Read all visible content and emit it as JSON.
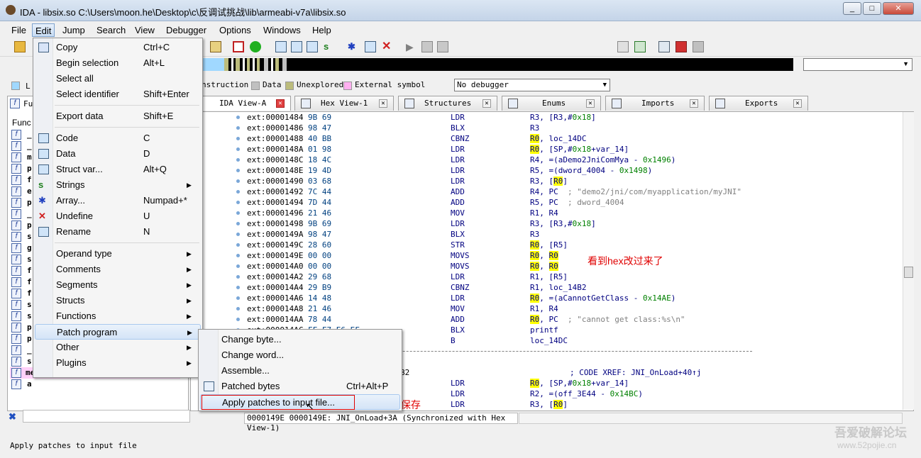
{
  "window": {
    "title": "IDA - libsix.so C:\\Users\\moon.he\\Desktop\\c\\反调试挑战\\lib\\armeabi-v7a\\libsix.so",
    "btn_min": "_",
    "btn_max": "□",
    "btn_close": "✕"
  },
  "menubar": {
    "items": [
      "File",
      "Edit",
      "Jump",
      "Search",
      "View",
      "Debugger",
      "Options",
      "Windows",
      "Help"
    ]
  },
  "toolbar": {
    "debugger_select": "No debugger"
  },
  "legend": {
    "instruction": "nstruction",
    "data": "Data",
    "unexplored": "Unexplored",
    "external": "External symbol",
    "instruction_color": "#a0d8ff",
    "data_color": "#c0c0c0",
    "unexplored_color": "#bcbc7c",
    "external_color": "#ffb0f0",
    "l": "L"
  },
  "tabs": [
    {
      "label": "IDA View-A",
      "active": true
    },
    {
      "label": "Hex View-1"
    },
    {
      "label": "Structures"
    },
    {
      "label": "Enums"
    },
    {
      "label": "Imports"
    },
    {
      "label": "Exports"
    }
  ],
  "left_panel": {
    "tab_label": "Fu",
    "header": "Func",
    "pink_label": "memcpy",
    "prefixes": [
      "_",
      "_",
      "m",
      "p",
      "f",
      "e",
      "p",
      "_",
      "p",
      "s",
      "g",
      "s",
      "f",
      "f",
      "f",
      "s",
      "s",
      "p",
      "p",
      "_",
      "s",
      "a"
    ]
  },
  "code": [
    {
      "addr": "ext:00001484",
      "hex": "9B 69",
      "mn": "LDR",
      "ops": [
        [
          "R3, [R3,#",
          ""
        ],
        [
          "0x18",
          "gr"
        ],
        [
          "]",
          ""
        ]
      ]
    },
    {
      "addr": "ext:00001486",
      "hex": "98 47",
      "mn": "BLX",
      "ops": [
        [
          "R3",
          ""
        ]
      ]
    },
    {
      "addr": "ext:00001488",
      "hex": "40 BB",
      "mn": "CBNZ",
      "ops": [
        [
          "R0",
          "hl"
        ],
        [
          ", loc_14DC",
          ""
        ]
      ]
    },
    {
      "addr": "ext:0000148A",
      "hex": "01 98",
      "mn": "LDR",
      "ops": [
        [
          "R0",
          "hl"
        ],
        [
          ", [SP,#",
          ""
        ],
        [
          "0x18",
          "gr"
        ],
        [
          "+var_14]",
          ""
        ]
      ]
    },
    {
      "addr": "ext:0000148C",
      "hex": "18 4C",
      "mn": "LDR",
      "ops": [
        [
          "R4, =(aDemo2JniComMya - ",
          ""
        ],
        [
          "0x1496",
          "gr"
        ],
        [
          ")",
          ""
        ]
      ]
    },
    {
      "addr": "ext:0000148E",
      "hex": "19 4D",
      "mn": "LDR",
      "ops": [
        [
          "R5, =(dword_4004 - ",
          ""
        ],
        [
          "0x1498",
          "gr"
        ],
        [
          ")",
          ""
        ]
      ]
    },
    {
      "addr": "ext:00001490",
      "hex": "03 68",
      "mn": "LDR",
      "ops": [
        [
          "R3, [",
          ""
        ],
        [
          "R0",
          "hl"
        ],
        [
          "]",
          ""
        ]
      ]
    },
    {
      "addr": "ext:00001492",
      "hex": "7C 44",
      "mn": "ADD",
      "ops": [
        [
          "R4, PC",
          ""
        ],
        [
          "  ; \"demo2/jni/com/myapplication/myJNI\"",
          "cm"
        ]
      ]
    },
    {
      "addr": "ext:00001494",
      "hex": "7D 44",
      "mn": "ADD",
      "ops": [
        [
          "R5, PC",
          ""
        ],
        [
          "  ; dword_4004",
          "cm"
        ]
      ]
    },
    {
      "addr": "ext:00001496",
      "hex": "21 46",
      "mn": "MOV",
      "ops": [
        [
          "R1, R4",
          ""
        ]
      ]
    },
    {
      "addr": "ext:00001498",
      "hex": "9B 69",
      "mn": "LDR",
      "ops": [
        [
          "R3, [R3,#",
          ""
        ],
        [
          "0x18",
          "gr"
        ],
        [
          "]",
          ""
        ]
      ]
    },
    {
      "addr": "ext:0000149A",
      "hex": "98 47",
      "mn": "BLX",
      "ops": [
        [
          "R3",
          ""
        ]
      ]
    },
    {
      "addr": "ext:0000149C",
      "hex": "28 60",
      "mn": "STR",
      "ops": [
        [
          "R0",
          "hl"
        ],
        [
          ", [R5]",
          ""
        ]
      ]
    },
    {
      "addr": "ext:0000149E",
      "hex": "00 00",
      "mn": "MOVS",
      "ops": [
        [
          "R0",
          "hl"
        ],
        [
          ", ",
          ""
        ],
        [
          "R0",
          "hl"
        ]
      ]
    },
    {
      "addr": "ext:000014A0",
      "hex": "00 00",
      "mn": "MOVS",
      "ops": [
        [
          "R0",
          "hl"
        ],
        [
          ", ",
          ""
        ],
        [
          "R0",
          "hl"
        ]
      ]
    },
    {
      "addr": "ext:000014A2",
      "hex": "29 68",
      "mn": "LDR",
      "ops": [
        [
          "R1, [R5]",
          ""
        ]
      ]
    },
    {
      "addr": "ext:000014A4",
      "hex": "29 B9",
      "mn": "CBNZ",
      "ops": [
        [
          "R1, loc_14B2",
          ""
        ]
      ]
    },
    {
      "addr": "ext:000014A6",
      "hex": "14 48",
      "mn": "LDR",
      "ops": [
        [
          "R0",
          "hl"
        ],
        [
          ", =(aCannotGetClass - ",
          ""
        ],
        [
          "0x14AE",
          "gr"
        ],
        [
          ")",
          ""
        ]
      ]
    },
    {
      "addr": "ext:000014A8",
      "hex": "21 46",
      "mn": "MOV",
      "ops": [
        [
          "R1, R4",
          ""
        ]
      ]
    },
    {
      "addr": "ext:000014AA",
      "hex": "78 44",
      "mn": "ADD",
      "ops": [
        [
          "R0",
          "hl"
        ],
        [
          ", PC",
          ""
        ],
        [
          "  ; \"cannot get class:%s\\n\"",
          "cm"
        ]
      ]
    },
    {
      "addr": "ext:000014AC",
      "hex": "FF F7 E6 EF",
      "mn": "BLX",
      "ops": [
        [
          "printf",
          ""
        ]
      ]
    },
    {
      "addr": "ext:000014B0",
      "hex": "14 E0",
      "mn": "B",
      "ops": [
        [
          "loc_14DC",
          ""
        ]
      ]
    }
  ],
  "code_lower": [
    {
      "addr": "",
      "hex": "",
      "mn": "",
      "ops": [],
      "xref": "; CODE XREF: JNI_OnLoad+40↑j",
      "frag": "B2"
    },
    {
      "addr": "",
      "hex": "",
      "mn": "LDR",
      "ops": [
        [
          "R0",
          "hl"
        ],
        [
          ", [SP,#",
          ""
        ],
        [
          "0x18",
          "gr"
        ],
        [
          "+var_14]",
          ""
        ]
      ]
    },
    {
      "addr": "",
      "hex": "",
      "mn": "LDR",
      "ops": [
        [
          "R2, =(off_3E44 - ",
          ""
        ],
        [
          "0x14BC",
          "gr"
        ],
        [
          ")",
          ""
        ]
      ]
    },
    {
      "addr": "",
      "hex": "",
      "mn": "LDR",
      "ops": [
        [
          "R3, [",
          ""
        ],
        [
          "R0",
          "hl"
        ],
        [
          "]",
          ""
        ]
      ]
    }
  ],
  "status_line": "0000149E 0000149E: JNI_OnLoad+3A (Synchronized with Hex View-1)",
  "statusbar": "Apply patches to input file",
  "annotations": {
    "hex_changed": "看到hex改过来了",
    "click_here": "点这  修改保存"
  },
  "watermark": {
    "line1": "吾爱破解论坛",
    "line2": "www.52pojie.cn"
  },
  "edit_menu": {
    "items": [
      {
        "label": "Copy",
        "shortcut": "Ctrl+C",
        "icon": "copy"
      },
      {
        "label": "Begin selection",
        "shortcut": "Alt+L"
      },
      {
        "label": "Select all",
        "shortcut": ""
      },
      {
        "label": "Select identifier",
        "shortcut": "Shift+Enter"
      },
      {
        "sep": true
      },
      {
        "label": "Export data",
        "shortcut": "Shift+E"
      },
      {
        "sep": true
      },
      {
        "label": "Code",
        "shortcut": "C",
        "icon": "code"
      },
      {
        "label": "Data",
        "shortcut": "D",
        "icon": "data"
      },
      {
        "label": "Struct var...",
        "shortcut": "Alt+Q",
        "icon": "struct"
      },
      {
        "label": "Strings",
        "shortcut": "",
        "submenu": true,
        "icon": "strings"
      },
      {
        "label": "Array...",
        "shortcut": "Numpad+*",
        "icon": "array"
      },
      {
        "label": "Undefine",
        "shortcut": "U",
        "icon": "undefine"
      },
      {
        "label": "Rename",
        "shortcut": "N",
        "icon": "rename"
      },
      {
        "sep": true
      },
      {
        "label": "Operand type",
        "submenu": true
      },
      {
        "label": "Comments",
        "submenu": true
      },
      {
        "label": "Segments",
        "submenu": true
      },
      {
        "label": "Structs",
        "submenu": true
      },
      {
        "label": "Functions",
        "submenu": true
      },
      {
        "label": "Patch program",
        "submenu": true,
        "hot": true
      },
      {
        "label": "Other",
        "submenu": true
      },
      {
        "label": "Plugins",
        "submenu": true
      }
    ]
  },
  "patch_menu": {
    "items": [
      {
        "label": "Change byte..."
      },
      {
        "label": "Change word..."
      },
      {
        "label": "Assemble..."
      },
      {
        "label": "Patched bytes",
        "shortcut": "Ctrl+Alt+P",
        "icon": "patched"
      },
      {
        "label": "Apply patches to input file...",
        "hot": true
      }
    ]
  }
}
